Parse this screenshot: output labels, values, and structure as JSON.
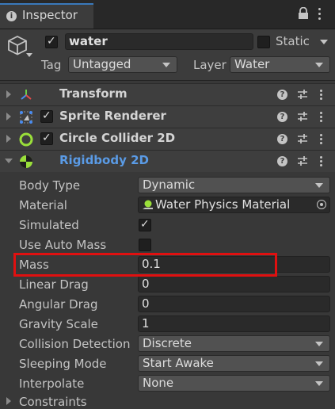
{
  "tab": {
    "label": "Inspector",
    "info_glyph": "i"
  },
  "game_object": {
    "active": true,
    "name": "water",
    "static_label": "Static",
    "static": false,
    "tag_label": "Tag",
    "tag_value": "Untagged",
    "layer_label": "Layer",
    "layer_value": "Water"
  },
  "components": [
    {
      "name": "Transform",
      "expanded": false,
      "has_checkbox": false
    },
    {
      "name": "Sprite Renderer",
      "expanded": false,
      "has_checkbox": true,
      "enabled": true
    },
    {
      "name": "Circle Collider 2D",
      "expanded": false,
      "has_checkbox": true,
      "enabled": true
    },
    {
      "name": "Rigidbody 2D",
      "expanded": true,
      "has_checkbox": false
    }
  ],
  "help_glyph": "?",
  "rigidbody": {
    "body_type": {
      "label": "Body Type",
      "value": "Dynamic"
    },
    "material": {
      "label": "Material",
      "value": "Water Physics Material"
    },
    "simulated": {
      "label": "Simulated",
      "checked": true
    },
    "use_auto_mass": {
      "label": "Use Auto Mass",
      "checked": false
    },
    "mass": {
      "label": "Mass",
      "value": "0.1"
    },
    "linear_drag": {
      "label": "Linear Drag",
      "value": "0"
    },
    "angular_drag": {
      "label": "Angular Drag",
      "value": "0"
    },
    "gravity_scale": {
      "label": "Gravity Scale",
      "value": "1"
    },
    "collision_detection": {
      "label": "Collision Detection",
      "value": "Discrete"
    },
    "sleeping_mode": {
      "label": "Sleeping Mode",
      "value": "Start Awake"
    },
    "interpolate": {
      "label": "Interpolate",
      "value": "None"
    },
    "constraints": {
      "label": "Constraints"
    }
  },
  "colors": {
    "accent_blue": "#5a9be6",
    "highlight_red": "#e01010",
    "background": "#383838"
  }
}
